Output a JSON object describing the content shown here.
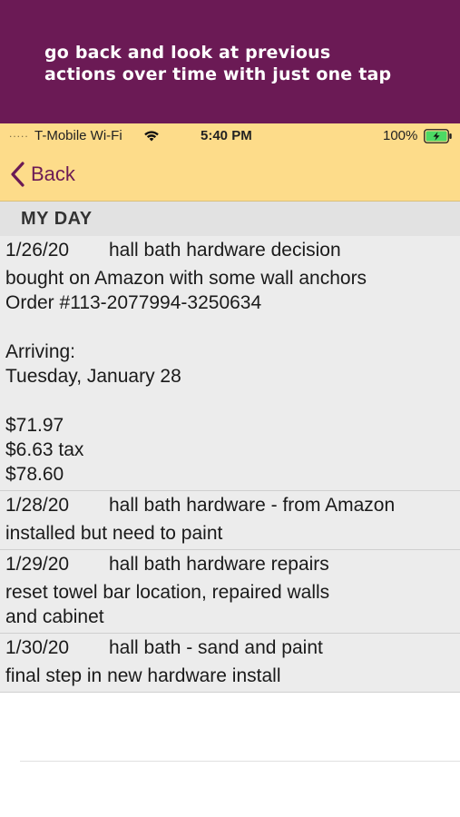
{
  "promo": {
    "line1": "go back and look at previous",
    "line2": "actions over time with just one tap"
  },
  "status_bar": {
    "signal": ".....",
    "carrier": "T-Mobile Wi-Fi",
    "time": "5:40 PM",
    "battery": "100%"
  },
  "nav": {
    "back_label": "Back"
  },
  "section": {
    "title": "MY DAY"
  },
  "entries": [
    {
      "date": "1/26/20",
      "title": "hall bath hardware decision",
      "note": "bought on Amazon with some wall anchors\nOrder #113-2077994-3250634\n\nArriving:\nTuesday, January 28\n\n$71.97\n$6.63  tax\n$78.60"
    },
    {
      "date": "1/28/20",
      "title": "hall bath hardware - from Amazon",
      "note": "installed but need to paint"
    },
    {
      "date": "1/29/20",
      "title": "hall bath hardware repairs",
      "note": "reset towel bar location, repaired walls\nand cabinet"
    },
    {
      "date": "1/30/20",
      "title": "hall bath - sand and paint",
      "note": "final step in new hardware install"
    }
  ],
  "colors": {
    "banner": "#6b1a55",
    "header": "#fddc8a",
    "accent": "#6b1a55",
    "battery": "#4cd964"
  }
}
